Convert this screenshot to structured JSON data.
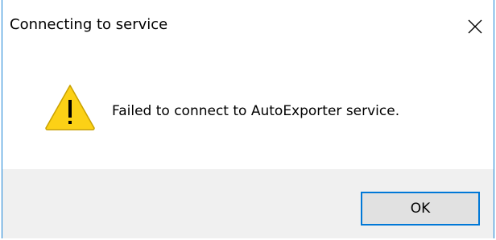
{
  "window": {
    "title": "Connecting to service",
    "close_icon": "close-icon"
  },
  "content": {
    "icon": "warning-icon",
    "message": "Failed to connect to AutoExporter service."
  },
  "footer": {
    "ok_label": "OK"
  },
  "colors": {
    "accent": "#0078d7",
    "window_border": "#1883d7",
    "footer_bg": "#f0f0f0",
    "button_bg": "#e1e1e1",
    "warning_fill": "#fcd116"
  }
}
